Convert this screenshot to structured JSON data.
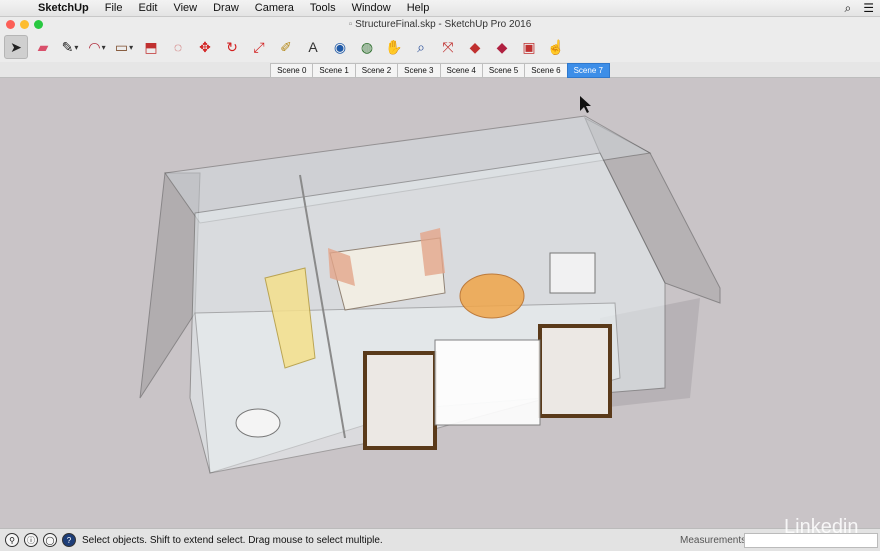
{
  "menubar": {
    "app": "SketchUp",
    "items": [
      "File",
      "Edit",
      "View",
      "Draw",
      "Camera",
      "Tools",
      "Window",
      "Help"
    ]
  },
  "window": {
    "title": "StructureFinal.skp - SketchUp Pro 2016"
  },
  "toolbar": {
    "tools": [
      {
        "name": "select-tool-icon",
        "glyph": "➤",
        "color": "#222"
      },
      {
        "name": "eraser-tool-icon",
        "glyph": "▰",
        "color": "#d9506b"
      },
      {
        "name": "pencil-tool-icon",
        "glyph": "✎",
        "color": "#222"
      },
      {
        "name": "arc-tool-icon",
        "glyph": "◠",
        "color": "#b02a3a"
      },
      {
        "name": "rectangle-tool-icon",
        "glyph": "▭",
        "color": "#7b4a2a"
      },
      {
        "name": "pushpull-tool-icon",
        "glyph": "⬒",
        "color": "#c0302f"
      },
      {
        "name": "offset-tool-icon",
        "glyph": "◌",
        "color": "#c0302f"
      },
      {
        "name": "move-tool-icon",
        "glyph": "✥",
        "color": "#d22020"
      },
      {
        "name": "rotate-tool-icon",
        "glyph": "↻",
        "color": "#d22020"
      },
      {
        "name": "scale-tool-icon",
        "glyph": "⤢",
        "color": "#d22020"
      },
      {
        "name": "tape-measure-icon",
        "glyph": "✐",
        "color": "#b58a1c"
      },
      {
        "name": "text-tool-icon",
        "glyph": "A",
        "color": "#333"
      },
      {
        "name": "paint-bucket-icon",
        "glyph": "◉",
        "color": "#1f5aa8"
      },
      {
        "name": "orbit-tool-icon",
        "glyph": "◍",
        "color": "#2c6e2c"
      },
      {
        "name": "pan-tool-icon",
        "glyph": "✋",
        "color": "#c79a4a"
      },
      {
        "name": "zoom-tool-icon",
        "glyph": "⌕",
        "color": "#2a4f9a"
      },
      {
        "name": "zoom-extents-icon",
        "glyph": "⤧",
        "color": "#c0302f"
      },
      {
        "name": "warehouse-icon",
        "glyph": "◆",
        "color": "#c0302f"
      },
      {
        "name": "extension-warehouse-icon",
        "glyph": "◆",
        "color": "#b02040"
      },
      {
        "name": "share-model-icon",
        "glyph": "▣",
        "color": "#c0302f"
      },
      {
        "name": "layout-icon",
        "glyph": "☝",
        "color": "#555"
      }
    ]
  },
  "scenes": [
    "Scene 0",
    "Scene 1",
    "Scene 2",
    "Scene 3",
    "Scene 4",
    "Scene 5",
    "Scene 6",
    "Scene 7"
  ],
  "active_scene": "Scene 7",
  "statusbar": {
    "message": "Select objects. Shift to extend select. Drag mouse to select multiple.",
    "measurements_label": "Measurements",
    "measurements_value": ""
  },
  "watermark": "Linkedin",
  "colors": {
    "viewport": "#c9c4c7",
    "accent": "#3d8ee8"
  }
}
